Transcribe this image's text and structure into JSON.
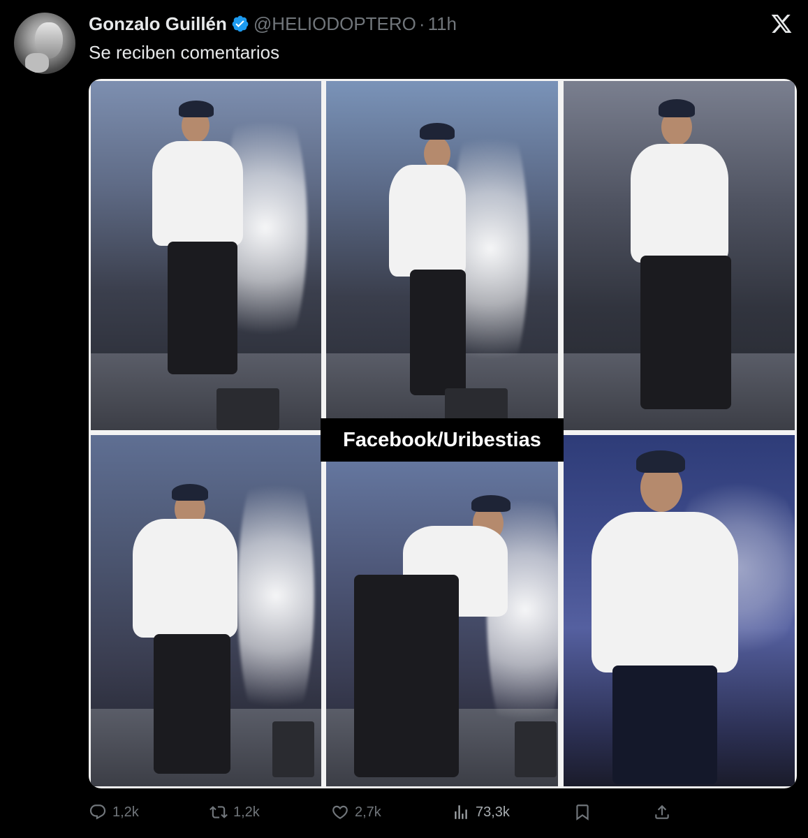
{
  "author": {
    "name": "Gonzalo Guillén",
    "handle": "@HELIODOPTERO",
    "separator": "·",
    "time": "11h",
    "verified": true,
    "verified_color": "#1d9bf0"
  },
  "tweet": {
    "text": "Se reciben comentarios"
  },
  "media": {
    "watermark": "Facebook/Uribestias",
    "photo_count": 6
  },
  "actions": {
    "replies": "1,2k",
    "reposts": "1,2k",
    "likes": "2,7k",
    "views": "73,3k"
  },
  "icons": {
    "brand": "x-logo-icon",
    "reply": "reply-icon",
    "repost": "repost-icon",
    "like": "heart-icon",
    "views": "views-icon",
    "bookmark": "bookmark-icon",
    "share": "share-icon"
  },
  "colors": {
    "background": "#000000",
    "text": "#e7e9ea",
    "muted": "#71767b"
  }
}
